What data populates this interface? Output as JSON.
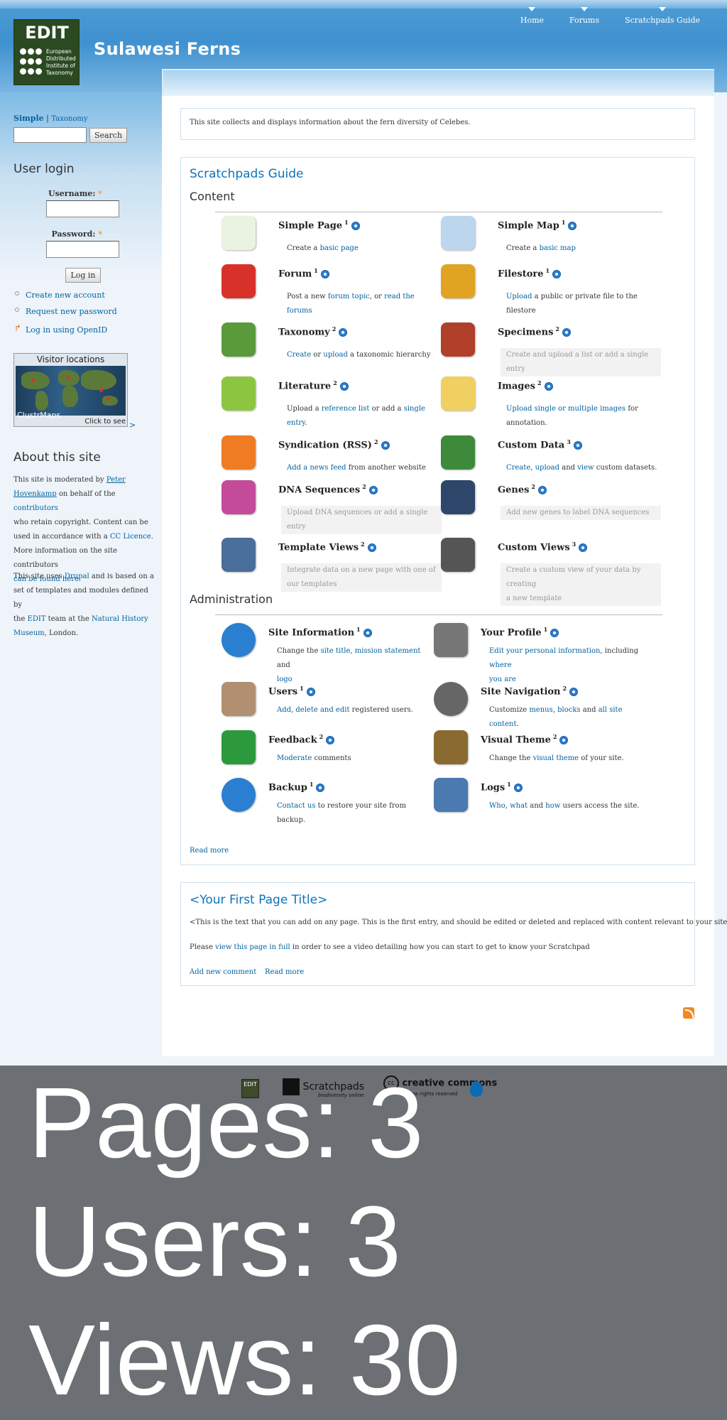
{
  "header": {
    "logo": {
      "text": "EDIT",
      "subtext": "European Distributed Institute of Taxonomy"
    },
    "site_name": "Sulawesi Ferns",
    "nav": [
      {
        "label": "Home"
      },
      {
        "label": "Forums"
      },
      {
        "label": "Scratchpads Guide"
      }
    ]
  },
  "sidebar": {
    "search_tab_simple": "Simple",
    "search_tab_sep": "|",
    "search_tab_taxonomy": "Taxonomy",
    "search_button": "Search",
    "user_login_title": "User login",
    "username_label": "Username:",
    "password_label": "Password:",
    "required_mark": "*",
    "login_button": "Log in",
    "links": [
      {
        "label": "Create new account"
      },
      {
        "label": "Request new password"
      },
      {
        "label": "Log in using OpenID"
      }
    ],
    "visitor_locations": {
      "title": "Visitor locations",
      "brand": "ClustrMaps",
      "click": "Click to see",
      "arrow": ">"
    },
    "about_title": "About this site",
    "about_p1": [
      "This site is moderated by ",
      "Peter",
      "Hovenkamp",
      " on behalf of the ",
      "contributors",
      "who retain copyright. Content can be",
      "used in accordance with a ",
      "CC Licence",
      ".",
      "More information on the site contributors",
      "can be found here",
      "."
    ],
    "about_p2": [
      "This site uses ",
      "Drupal",
      " and is based on a",
      "set of templates and modules defined by",
      "the ",
      "EDIT",
      " team at the ",
      "Natural History",
      "Museum",
      ", London."
    ]
  },
  "mission": "This site collects and displays information about the fern diversity of Celebes.",
  "guide": {
    "title": "Scratchpads Guide",
    "content_title": "Content",
    "admin_title": "Administration",
    "read_more": "Read more",
    "content_items": [
      {
        "name": "Simple Page",
        "sup": "1",
        "desc": [
          "Create a ",
          "basic page"
        ],
        "icon": "simple-page-icon"
      },
      {
        "name": "Simple Map",
        "sup": "1",
        "desc": [
          "Create a ",
          "basic map"
        ],
        "icon": "simple-map-icon"
      },
      {
        "name": "Forum",
        "sup": "1",
        "desc": [
          "Post a new ",
          "forum topic",
          ", or ",
          "read the",
          "forums"
        ],
        "icon": "forum-icon"
      },
      {
        "name": "Filestore",
        "sup": "1",
        "desc": [
          "Upload",
          " a public or private file to the filestore"
        ],
        "icon": "filestore-icon"
      },
      {
        "name": "Taxonomy",
        "sup": "2",
        "desc": [
          "Create",
          " or ",
          "upload",
          " a taxonomic hierarchy"
        ],
        "icon": "taxonomy-icon"
      },
      {
        "name": "Specimens",
        "sup": "2",
        "desc": [
          "Create and upload a list or add a single entry"
        ],
        "icon": "specimens-icon"
      },
      {
        "name": "Literature",
        "sup": "2",
        "desc": [
          "Upload a ",
          "reference list",
          " or add a ",
          "single",
          "entry",
          "."
        ],
        "icon": "literature-icon"
      },
      {
        "name": "Images",
        "sup": "2",
        "desc": [
          "Upload single or multiple images",
          " for",
          "annotation."
        ],
        "icon": "images-icon"
      },
      {
        "name": "Syndication (RSS)",
        "sup": "2",
        "desc": [
          "Add a news feed",
          " from another website"
        ],
        "icon": "rss-feed-icon"
      },
      {
        "name": "Custom Data",
        "sup": "3",
        "desc": [
          "Create",
          ", ",
          "upload",
          " and ",
          "view",
          " custom datasets."
        ],
        "icon": "custom-data-icon"
      },
      {
        "name": "DNA Sequences",
        "sup": "2",
        "desc": [
          "Upload DNA sequences or add a single",
          "entry"
        ],
        "icon": "dna-icon"
      },
      {
        "name": "Genes",
        "sup": "2",
        "desc": [
          "Add new genes to label DNA sequences"
        ],
        "icon": "genes-icon"
      },
      {
        "name": "Template Views",
        "sup": "2",
        "desc": [
          "Integrate data on a new page with one of",
          "our templates"
        ],
        "icon": "template-views-icon"
      },
      {
        "name": "Custom Views",
        "sup": "3",
        "desc": [
          "Create a custom view of your data by creating",
          "a new template"
        ],
        "icon": "custom-views-icon"
      }
    ],
    "admin_items": [
      {
        "name": "Site Information",
        "sup": "1",
        "desc": [
          "Change the ",
          "site title",
          ", ",
          "mission statement",
          " and",
          "logo"
        ],
        "icon": "info-icon"
      },
      {
        "name": "Your Profile",
        "sup": "1",
        "desc": [
          "Edit your personal information",
          ", including ",
          "where",
          "you are"
        ],
        "icon": "profile-icon"
      },
      {
        "name": "Users",
        "sup": "1",
        "desc": [
          "Add",
          ", ",
          "delete and edit",
          " registered users."
        ],
        "icon": "users-icon"
      },
      {
        "name": "Site Navigation",
        "sup": "2",
        "desc": [
          "Customize ",
          "menus",
          ", ",
          "blocks",
          " and ",
          "all site content",
          "."
        ],
        "icon": "compass-icon"
      },
      {
        "name": "Feedback",
        "sup": "2",
        "desc": [
          "Moderate",
          " comments"
        ],
        "icon": "feedback-icon"
      },
      {
        "name": "Visual Theme",
        "sup": "2",
        "desc": [
          "Change the ",
          "visual theme",
          " of your site."
        ],
        "icon": "theme-icon"
      },
      {
        "name": "Backup",
        "sup": "1",
        "desc": [
          "Contact us",
          " to restore your site from",
          "backup."
        ],
        "icon": "backup-icon"
      },
      {
        "name": "Logs",
        "sup": "1",
        "desc": [
          "Who",
          ", ",
          "what",
          " and ",
          "how",
          " users access the site."
        ],
        "icon": "logs-icon"
      }
    ]
  },
  "first_page": {
    "title": "<Your First Page Title>",
    "body": "<This is the text that you can add on any page. This is the first entry, and should be edited or deleted and replaced with content relevant to your site>",
    "view_prefix": "Please ",
    "view_link": "view this page in full",
    "view_suffix": " in order to see a video detailing how you can start to get to know your Scratchpad",
    "add_comment": "Add new comment",
    "read_more": "Read more"
  },
  "footer": {
    "logos": [
      {
        "name": "EDIT"
      },
      {
        "name": "Scratchpads",
        "tag": "biodiversity online"
      },
      {
        "name": "creative commons",
        "tag": "some rights reserved"
      },
      {
        "name": "Drupal"
      }
    ],
    "stats": [
      {
        "label": "Pages: 3"
      },
      {
        "label": "Users: 3"
      },
      {
        "label": "Views: 30"
      }
    ]
  },
  "colors": {
    "link": "#0062a0",
    "header": "#3f91cf",
    "footer": "#6c6f73"
  }
}
